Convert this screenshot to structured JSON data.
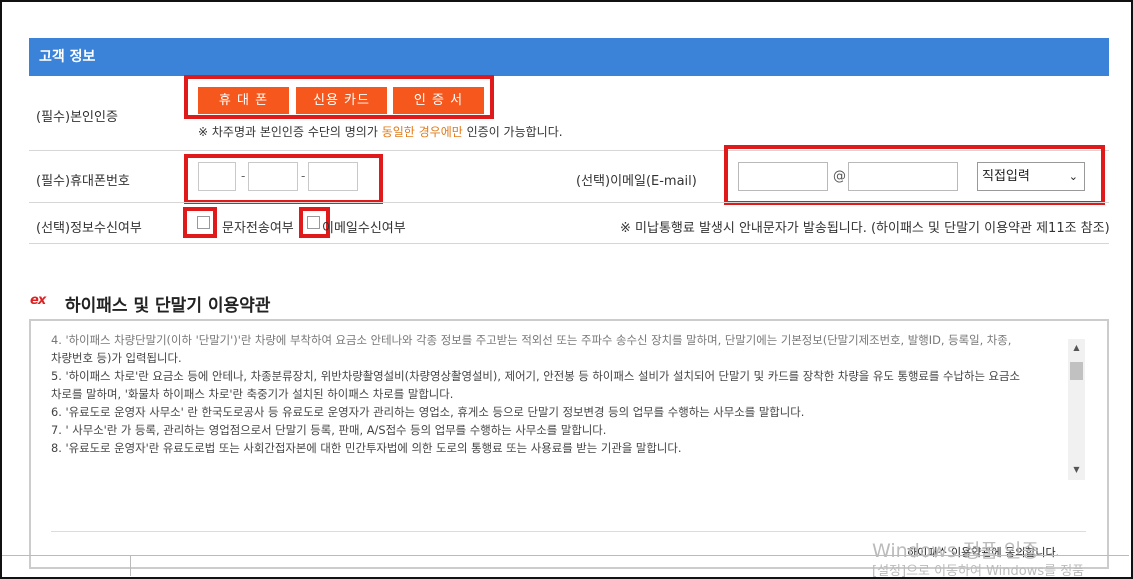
{
  "section": {
    "title": "고객 정보"
  },
  "auth": {
    "label": "(필수)본인인증",
    "buttons": [
      "휴 대 폰",
      "신용 카드",
      "인 증 서"
    ],
    "notice_pre": "※ 차주명과 본인인증 수단의 명의가 ",
    "notice_highlight": "동일한 경우에만",
    "notice_post": " 인증이 가능합니다."
  },
  "phone": {
    "label": "(필수)휴대폰번호",
    "sep": "-"
  },
  "email": {
    "label": "(선택)이메일(E-mail)",
    "at": "@",
    "select_value": "직접입력",
    "select_arrow": "⌄"
  },
  "consent": {
    "label": "(선택)정보수신여부",
    "sms_label": "문자전송여부",
    "email_label": "이메일수신여부",
    "notice": "※ 미납통행료 발생시 안내문자가 발송됩니다. (하이패스 및 단말기 이용약관 제11조 참조)"
  },
  "terms": {
    "logo": "ex",
    "title": "하이패스 및 단말기 이용약관",
    "lines": [
      "4. '하이패스 차량단말기(이하 '단말기')'란 차량에 부착하여 요금소 안테나와 각종 정보를 주고받는 적외선 또는 주파수 송수신 장치를 말하며, 단말기에는 기본정보(단말기제조번호, 발행ID, 등록일, 차종,",
      "차량번호 등)가 입력됩니다.",
      "5. '하이패스 차로'란 요금소 등에 안테나, 차종분류장치, 위반차량촬영설비(차량영상촬영설비), 제어기, 안전봉 등 하이패스 설비가 설치되어 단말기 및 카드를 장착한 차량을 유도 통행료를 수납하는 요금소",
      "차로를 말하며, '화물차 하이패스 차로'란 축중기가 설치된 하이패스 차로를 말합니다.",
      "6. '유료도로 운영자 사무소' 란 한국도로공사 등 유료도로 운영자가 관리하는 영업소, 휴게소 등으로 단말기 정보변경 등의 업무를 수행하는 사무소를 말합니다.",
      "7. ' 사무소'란 가 등록, 관리하는 영업점으로서 단말기 등록, 판매, A/S접수 등의 업무를 수행하는 사무소를 말합니다.",
      "8. '유료도로 운영자'란 유료도로법 또는 사회간접자본에 대한 민간투자법에 의한 도로의 통행료 또는 사용료를 받는 기관을 말합니다."
    ],
    "agree": "하이패스 이용약관에 동의합니다.",
    "scroll_up": "▲",
    "scroll_down": "▼"
  },
  "watermark": {
    "line1": "Windows 정품 인증",
    "line2": "[설정]으로 이동하여 Windows를 정품"
  }
}
